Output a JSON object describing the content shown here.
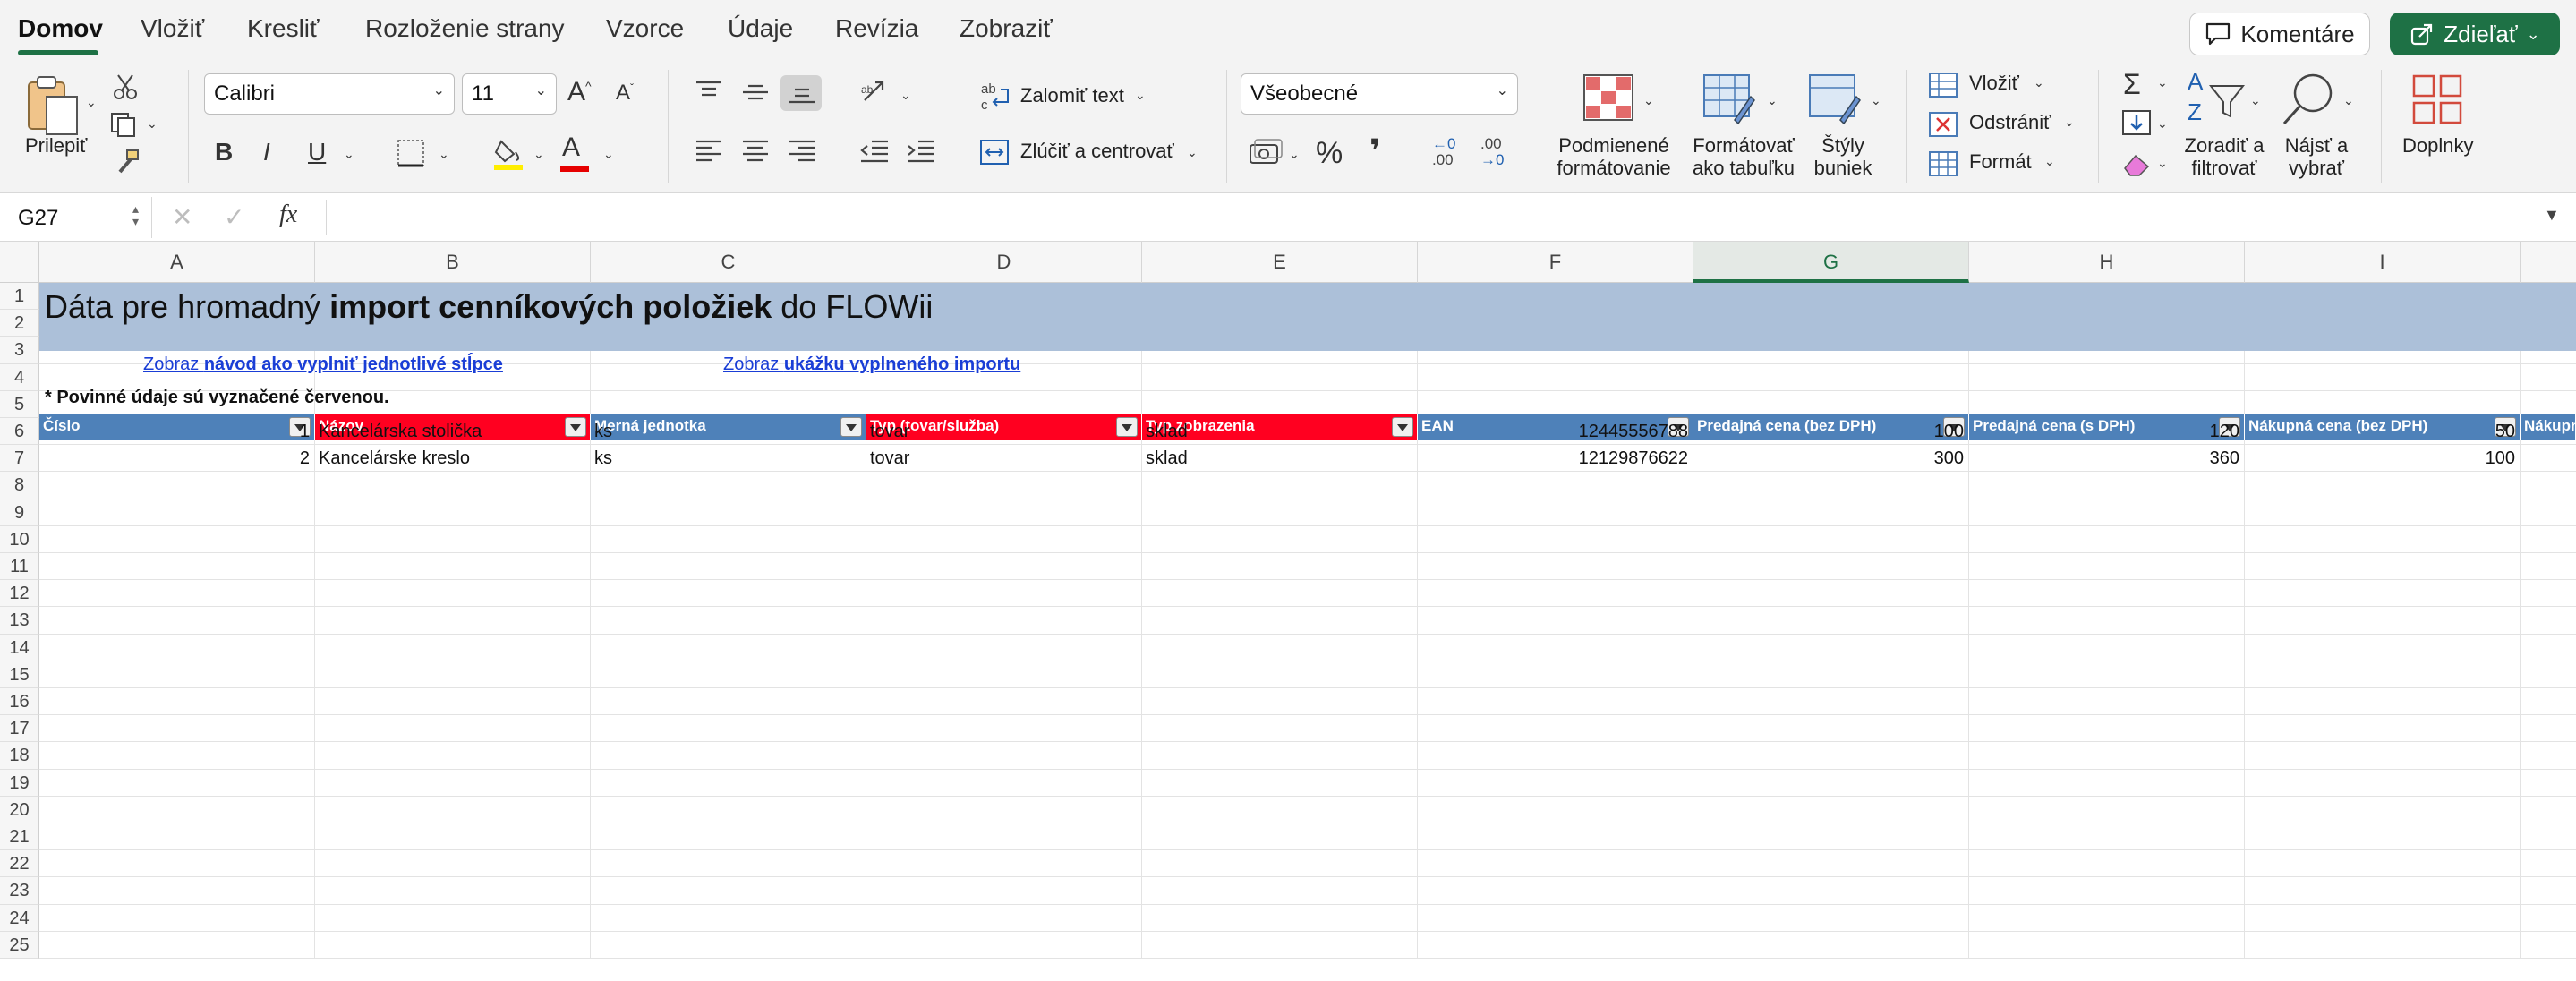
{
  "tabs": [
    "Domov",
    "Vložiť",
    "Kresliť",
    "Rozloženie strany",
    "Vzorce",
    "Údaje",
    "Revízia",
    "Zobraziť"
  ],
  "header_buttons": {
    "comments": "Komentáre",
    "share": "Zdieľať"
  },
  "ribbon": {
    "paste": "Prilepiť",
    "font_name": "Calibri",
    "font_size": "11",
    "wrap_text": "Zalomiť text",
    "merge_center": "Zlúčiť a centrovať",
    "number_format": "Všeobecné",
    "conditional_formatting": [
      "Podmienené",
      "formátovanie"
    ],
    "format_as_table": [
      "Formátovať",
      "ako tabuľku"
    ],
    "cell_styles": [
      "Štýly",
      "buniek"
    ],
    "insert": "Vložiť",
    "delete": "Odstrániť",
    "format": "Formát",
    "sort_filter": [
      "Zoradiť a",
      "filtrovať"
    ],
    "find_select": [
      "Nájsť a",
      "vybrať"
    ],
    "addins": "Doplnky",
    "bold": "B",
    "italic": "I",
    "underline": "U",
    "text_color_glyph": "A",
    "percent": "%",
    "comma": "❜",
    "inc_decimal_top": "←0",
    "inc_decimal_bottom": ".00",
    "dec_decimal_top": ".00",
    "dec_decimal_bottom": "→0",
    "sum_glyph": "Σ",
    "sort_glyph_a": "A",
    "sort_glyph_z": "Z"
  },
  "formula_bar": {
    "name_box": "G27",
    "fx": "fx",
    "formula": ""
  },
  "columns": [
    "A",
    "B",
    "C",
    "D",
    "E",
    "F",
    "G",
    "H",
    "I"
  ],
  "selected_column": "G",
  "rows": [
    "1",
    "2",
    "3",
    "4",
    "5",
    "6",
    "7",
    "8",
    "9",
    "10",
    "11",
    "12",
    "13",
    "14",
    "15",
    "16",
    "17",
    "18",
    "19",
    "20",
    "21",
    "22",
    "23",
    "24",
    "25"
  ],
  "sheet": {
    "title_normal_1": "Dáta pre hromadný ",
    "title_bold": "import cenníkových položiek",
    "title_normal_2": " do FLOWii",
    "link1_prefix": "Zobraz ",
    "link1_bold": "návod ako vyplniť jednotlivé stĺpce",
    "link2_prefix": "Zobraz ",
    "link2_bold": "ukážku vyplneného importu",
    "required_note": "* Povinné údaje sú vyznačené červenou.",
    "headers": [
      "Číslo",
      "Názov",
      "Merná jednotka",
      "Typ (tovar/služba)",
      "Typ zobrazenia",
      "EAN",
      "Predajná cena (bez DPH)",
      "Predajná cena (s DPH)",
      "Nákupná cena (bez DPH)",
      "Nákupn"
    ],
    "data_rows": [
      [
        "1",
        "Kancelárska stolička",
        "ks",
        "tovar",
        "sklad",
        "12445556788",
        "100",
        "120",
        "50"
      ],
      [
        "2",
        "Kancelárske kreslo",
        "ks",
        "tovar",
        "sklad",
        "12129876622",
        "300",
        "360",
        "100"
      ]
    ]
  }
}
